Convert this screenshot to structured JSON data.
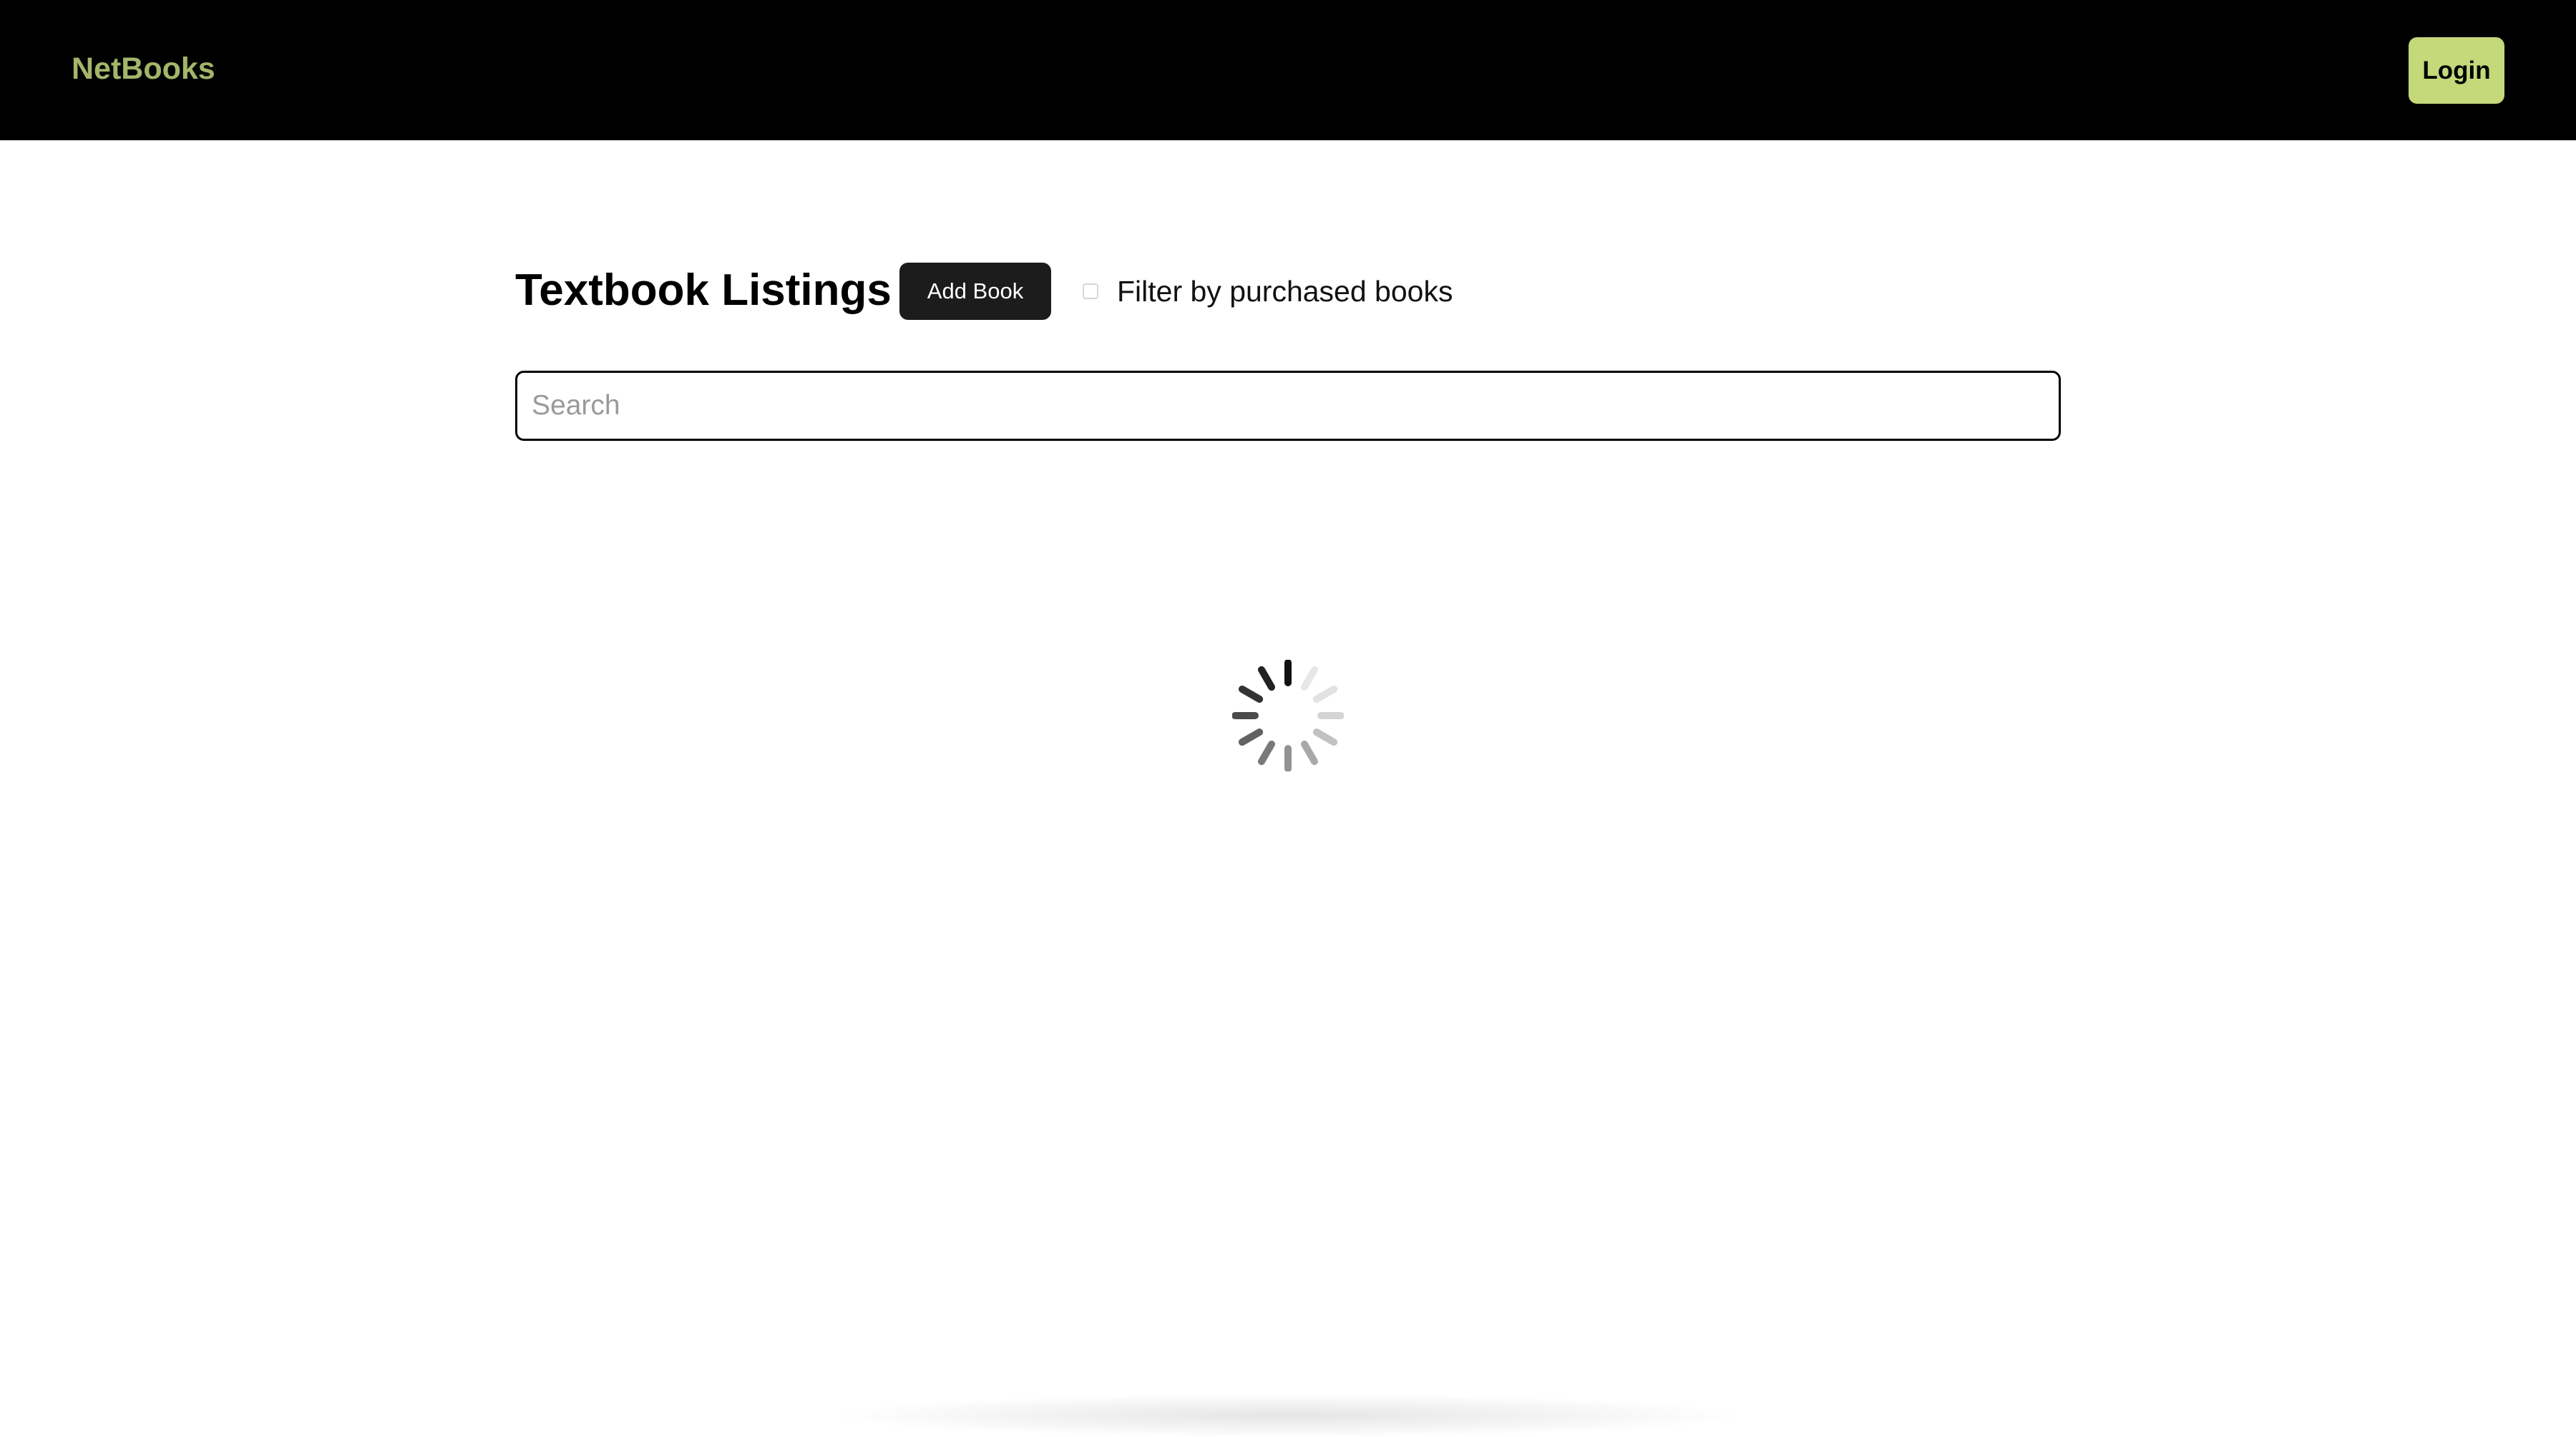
{
  "navbar": {
    "brand": "NetBooks",
    "login_label": "Login",
    "brand_color": "#a4b56a",
    "login_bg": "#c5d87a"
  },
  "main": {
    "title": "Textbook Listings",
    "add_book_label": "Add Book",
    "filter_label": "Filter by purchased books",
    "filter_checked": false,
    "search": {
      "placeholder": "Search",
      "value": ""
    }
  },
  "loading": {
    "icon": "loading-spinner-icon"
  }
}
